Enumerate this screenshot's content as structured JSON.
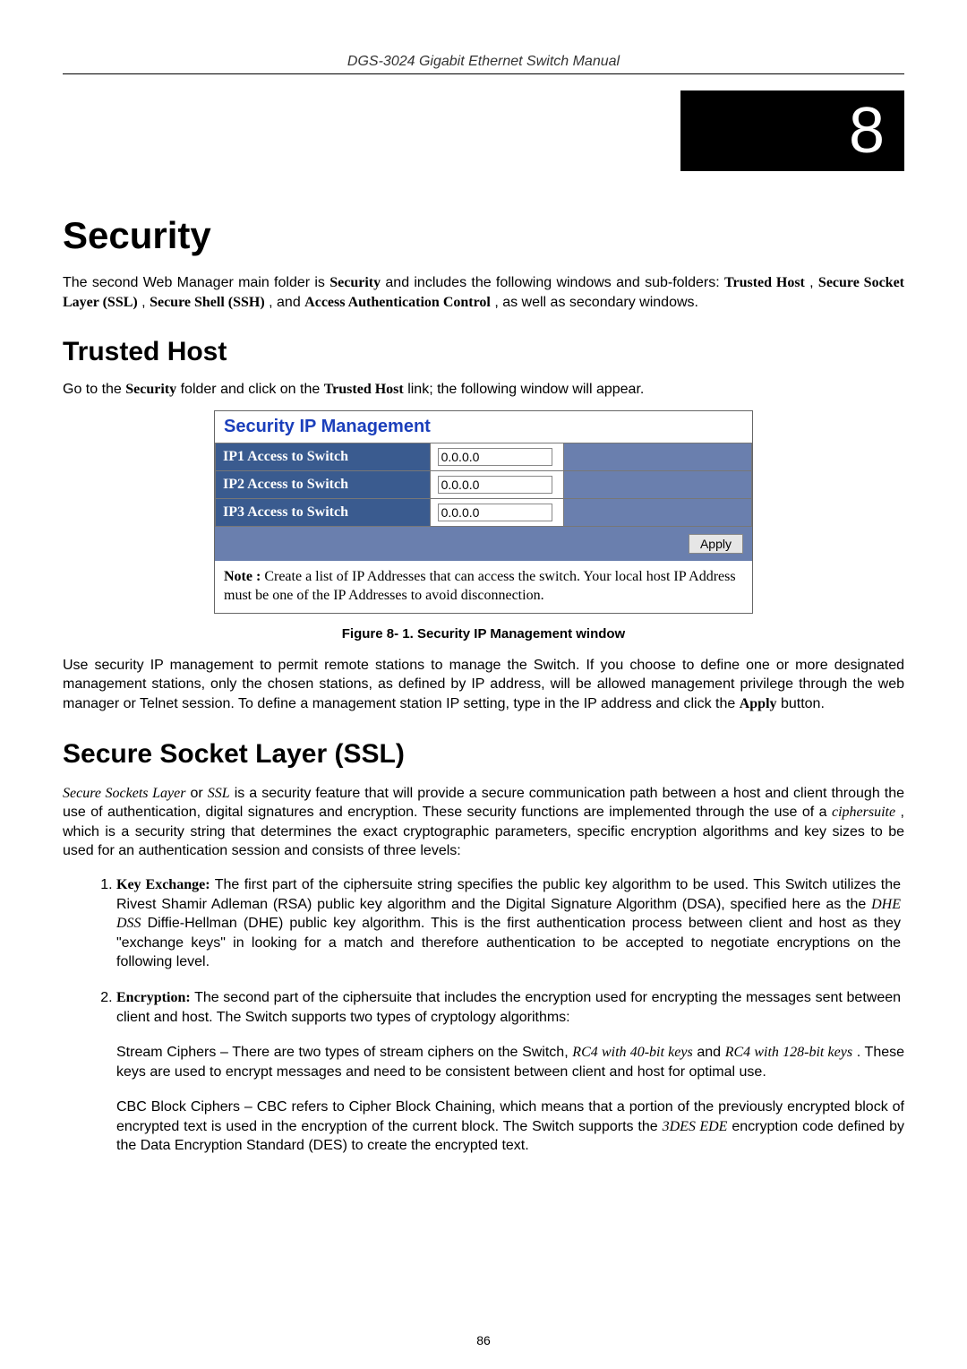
{
  "header": {
    "manual_title": "DGS-3024 Gigabit Ethernet Switch Manual"
  },
  "chapter": {
    "number": "8",
    "title": "Security"
  },
  "intro": {
    "text_pre": "The second Web Manager main folder is ",
    "bold1": "Security",
    "text_mid1": " and includes the following windows and sub-folders: ",
    "bold2": "Trusted Host",
    "sep1": ", ",
    "bold3": "Secure Socket Layer (SSL)",
    "sep2": ", ",
    "bold4": "Secure Shell (SSH)",
    "text_mid2": ", and ",
    "bold5": "Access Authentication Control",
    "text_end": ", as well as secondary windows."
  },
  "trusted_host": {
    "heading": "Trusted Host",
    "nav_pre": "Go to the ",
    "nav_b1": "Security",
    "nav_mid": " folder and click on the ",
    "nav_b2": "Trusted Host",
    "nav_end": " link; the following window will appear.",
    "figure": {
      "title": "Security IP Management",
      "rows": [
        {
          "label": "IP1 Access to Switch",
          "value": "0.0.0.0"
        },
        {
          "label": "IP2 Access to Switch",
          "value": "0.0.0.0"
        },
        {
          "label": "IP3 Access to Switch",
          "value": "0.0.0.0"
        }
      ],
      "apply_label": "Apply",
      "note_label": "Note :",
      "note_text": " Create a list of IP Addresses that can access the switch. Your local host IP Address must be one of the IP Addresses to avoid disconnection."
    },
    "caption": "Figure 8- 1. Security IP Management window",
    "desc_pre": "Use security IP management to permit remote stations to manage the Switch. If you choose to define one or more designated management stations, only the chosen stations, as defined by IP address, will be allowed management privilege through the web manager or Telnet session. To define a management station IP setting, type in the IP address and click the ",
    "desc_b": "Apply",
    "desc_end": " button."
  },
  "ssl": {
    "heading": "Secure Socket Layer (SSL)",
    "p1_i1": "Secure Sockets Layer",
    "p1_m1": " or ",
    "p1_i2": "SSL",
    "p1_m2": " is a security feature that will provide a secure communication path between a host and client through the use of authentication, digital signatures and encryption. These security functions are implemented through the use of a ",
    "p1_i3": "ciphersuite",
    "p1_m3": ", which is a security string that determines the exact cryptographic parameters, specific encryption algorithms and key sizes to be used for an authentication session and consists of three levels:",
    "item1_b": "Key Exchange:",
    "item1_t1": " The first part of the ciphersuite string specifies the public key algorithm to be used. This Switch utilizes the Rivest Shamir Adleman (RSA) public key algorithm and the Digital Signature Algorithm (DSA), specified here as the ",
    "item1_i": "DHE DSS",
    "item1_t2": " Diffie-Hellman (DHE) public key algorithm. This is the first authentication process between client and host as they \"exchange keys\" in looking for a match and therefore authentication to be accepted to negotiate encryptions on the following level.",
    "item2_b": "Encryption:",
    "item2_t": " The second part of the ciphersuite that includes the encryption used for encrypting the messages sent between client and host. The Switch supports two types of cryptology algorithms:",
    "stream_lead": "Stream Ciphers ",
    "stream_t1": "– There are two types of stream ciphers on the Switch, ",
    "stream_i1": "RC4 with 40-bit keys",
    "stream_m": " and ",
    "stream_i2": "RC4 with 128-bit keys",
    "stream_t2": ". These keys are used to encrypt messages and need to be consistent between client and host for optimal use.",
    "cbc_lead": "CBC Block Ciphers ",
    "cbc_t1": "– CBC refers to Cipher Block Chaining, which means that a portion of the previously encrypted block of encrypted text is used in the encryption of the current block. The Switch supports the ",
    "cbc_i": "3DES EDE",
    "cbc_t2": " encryption code defined by the Data Encryption Standard (DES) to create the encrypted text."
  },
  "page_number": "86"
}
